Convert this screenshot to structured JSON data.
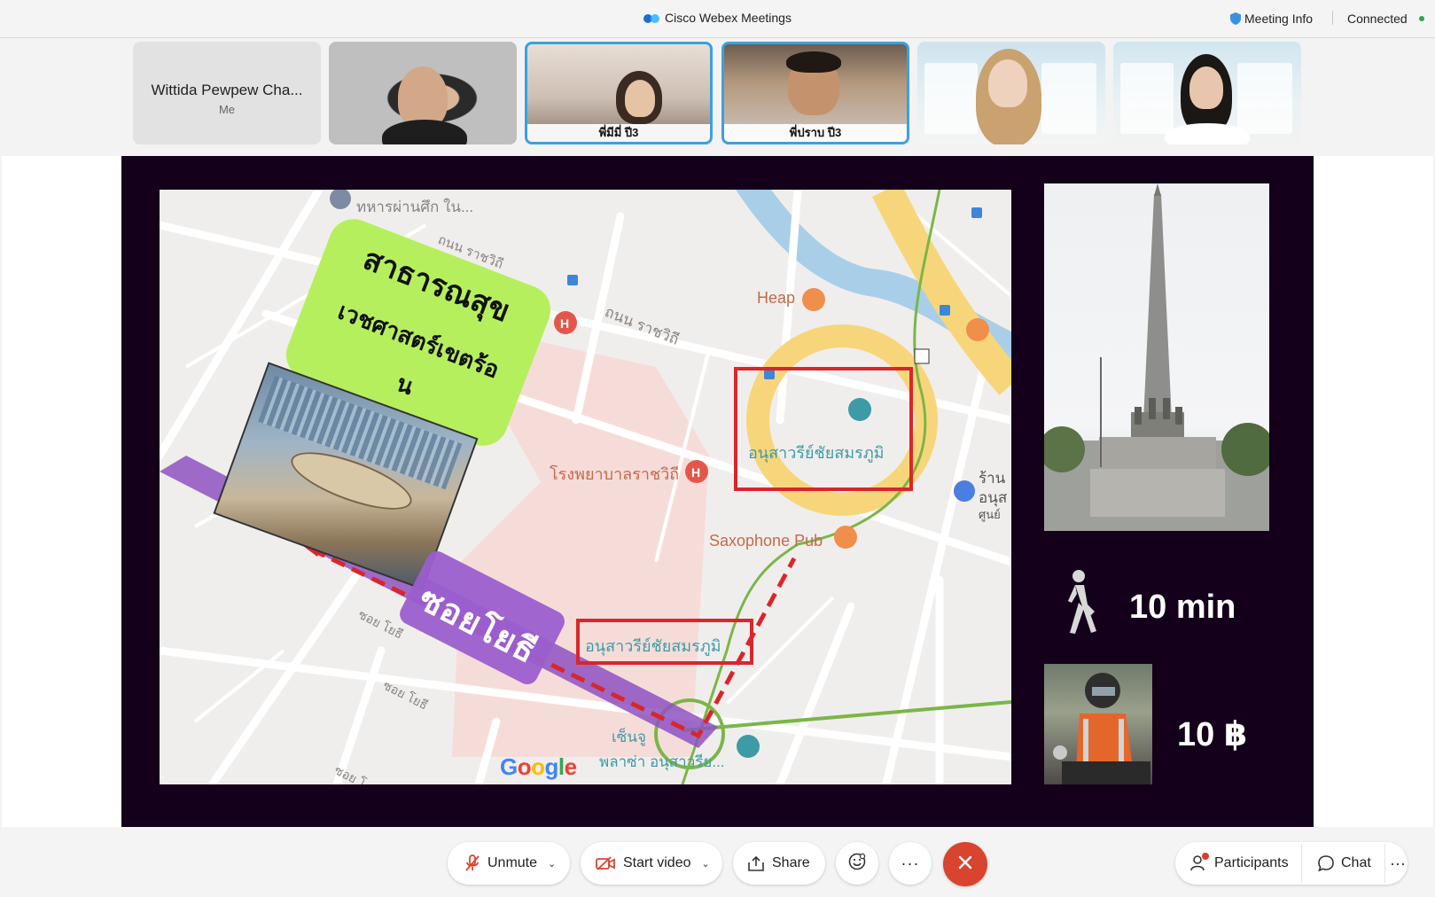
{
  "titlebar": {
    "app_title": "Cisco Webex Meetings",
    "meeting_info": "Meeting Info",
    "status": "Connected"
  },
  "participants": {
    "self": {
      "name": "Wittida Pewpew Cha...",
      "sub": "Me"
    },
    "tiles": [
      {
        "name": ""
      },
      {
        "name": "พี่มีมี่ ปี3"
      },
      {
        "name": "พี่ปราบ ปี3"
      },
      {
        "name": ""
      },
      {
        "name": ""
      }
    ]
  },
  "slide": {
    "map": {
      "sign_line1": "สาธารณสุข",
      "sign_line2": "เวชศาสตร์เขตร้อ",
      "sign_line3": "น",
      "soi_label": "ซอยโยธี",
      "poi_heap": "Heap",
      "poi_sax": "Saxophone Pub",
      "poi_hospital": "โรงพยาบาลราชวิถี",
      "poi_monument": "อนุสาวรีย์ชัยสมรภูมิ",
      "bts_station": "อนุสาวรีย์ชัยสมรภูมิ",
      "road_rajavithi_1": "ถนน ราชวิถี",
      "road_rajavithi_2": "ถนน ราชวิถี",
      "poi_top": "ทหารผ่านศึก ใน...",
      "plaza_line1": "เซ็นจู",
      "plaza_line2": "พลาซ่า อนุสาวรีย...",
      "soi_yothi_1": "ซอย โยธี",
      "soi_yothi_2": "ซอย โยธี",
      "soi_yothi_3": "ซอย โ",
      "shop_1": "ร้าน",
      "shop_2": "อนุส",
      "shop_3": "ศูนย์",
      "google": [
        "G",
        "o",
        "o",
        "g",
        "l",
        "e"
      ]
    },
    "walk_time": "10 min",
    "moto_fare": "10 ฿"
  },
  "controls": {
    "unmute": "Unmute",
    "start_video": "Start video",
    "share": "Share",
    "more": "···",
    "participants": "Participants",
    "chat": "Chat",
    "overflow": "···"
  },
  "colors": {
    "accent_blue": "#3aa1e0",
    "end_red": "#d9442e",
    "slide_bg": "#14001a",
    "sign_green": "#b6ef5d",
    "soi_purple": "#9b5ecf",
    "route_red": "#d9262b",
    "bts_green": "#7ab648"
  }
}
